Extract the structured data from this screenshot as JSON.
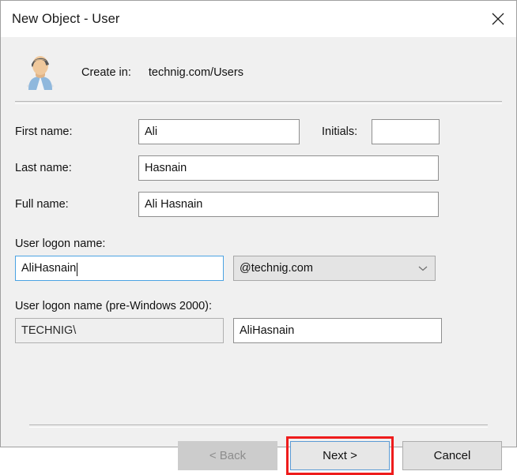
{
  "window": {
    "title": "New Object - User",
    "close_icon": "close-icon"
  },
  "header": {
    "avatar_icon": "user-avatar-icon",
    "create_in_label": "Create in:",
    "create_in_value": "technig.com/Users"
  },
  "form": {
    "first_name": {
      "label": "First name:",
      "value": "Ali",
      "placeholder": ""
    },
    "initials": {
      "label": "Initials:",
      "value": "",
      "placeholder": ""
    },
    "last_name": {
      "label": "Last name:",
      "value": "Hasnain",
      "placeholder": ""
    },
    "full_name": {
      "label": "Full name:",
      "value": "Ali Hasnain",
      "placeholder": ""
    },
    "user_logon_name": {
      "label": "User logon name:",
      "value": "AliHasnain",
      "placeholder": "",
      "focused": true
    },
    "upn_suffix": {
      "selected": "@technig.com",
      "options": [
        "@technig.com"
      ],
      "chevron_icon": "chevron-down-icon"
    },
    "pre_windows_2000": {
      "label": "User logon name (pre-Windows 2000):",
      "domain_value": "TECHNIG\\",
      "sam_value": "AliHasnain"
    }
  },
  "footer": {
    "back_label": "< Back",
    "next_label": "Next >",
    "cancel_label": "Cancel"
  },
  "annotation": {
    "highlight_color": "#ee1c1c",
    "target": "next-button"
  }
}
